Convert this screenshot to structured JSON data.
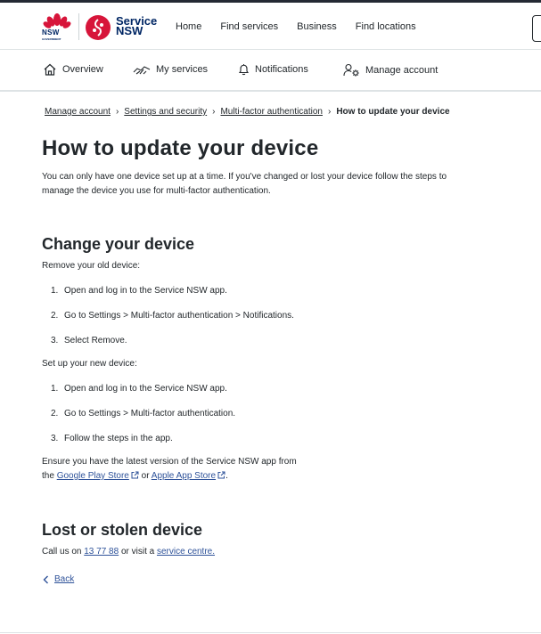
{
  "brand": {
    "gov_wordmark": "NSW",
    "gov_sub": "GOVERNMENT",
    "service_line1": "Service",
    "service_line2": "NSW",
    "gov_red": "#d7153a",
    "navy": "#002664"
  },
  "main_nav": [
    "Home",
    "Find services",
    "Business",
    "Find locations"
  ],
  "sub_nav": [
    {
      "label": "Overview",
      "icon": "home-icon"
    },
    {
      "label": "My services",
      "icon": "handshake-icon"
    },
    {
      "label": "Notifications",
      "icon": "bell-icon"
    },
    {
      "label": "Manage account",
      "icon": "user-settings-icon"
    }
  ],
  "breadcrumb": {
    "items": [
      "Manage account",
      "Settings and security",
      "Multi-factor authentication"
    ],
    "current": "How to update your device",
    "separator": "›"
  },
  "page": {
    "title": "How to update your device",
    "intro": "You can only have one device set up at a time. If you've changed or lost your device follow the steps to manage the device you use for multi-factor authentication."
  },
  "change_device": {
    "heading": "Change your device",
    "remove_label": "Remove your old device:",
    "remove_steps": [
      {
        "num": "1.",
        "text": "Open and log in to the Service NSW app."
      },
      {
        "num": "2.",
        "text": "Go to Settings > Multi-factor authentication > Notifications."
      },
      {
        "num": "3.",
        "text": "Select Remove."
      }
    ],
    "setup_label": "Set up your new device:",
    "setup_steps": [
      {
        "num": "1.",
        "text": "Open and log in to the Service NSW app."
      },
      {
        "num": "2.",
        "text": "Go to Settings > Multi-factor authentication."
      },
      {
        "num": "3.",
        "text": "Follow the steps in the app."
      }
    ],
    "ensure_line1": "Ensure you have the latest version of the Service NSW app from",
    "ensure_the": "the",
    "google_play": "Google Play Store",
    "or": "or",
    "app_store": "Apple App Store",
    "period": "."
  },
  "lost_device": {
    "heading": "Lost or stolen device",
    "call_prefix": "Call us on",
    "phone": "13 77 88",
    "visit": "or visit a",
    "centre": "service centre."
  },
  "back_label": "Back",
  "colors": {
    "text": "#22272b",
    "link": "#2e5299",
    "divider": "#dee3e5"
  }
}
